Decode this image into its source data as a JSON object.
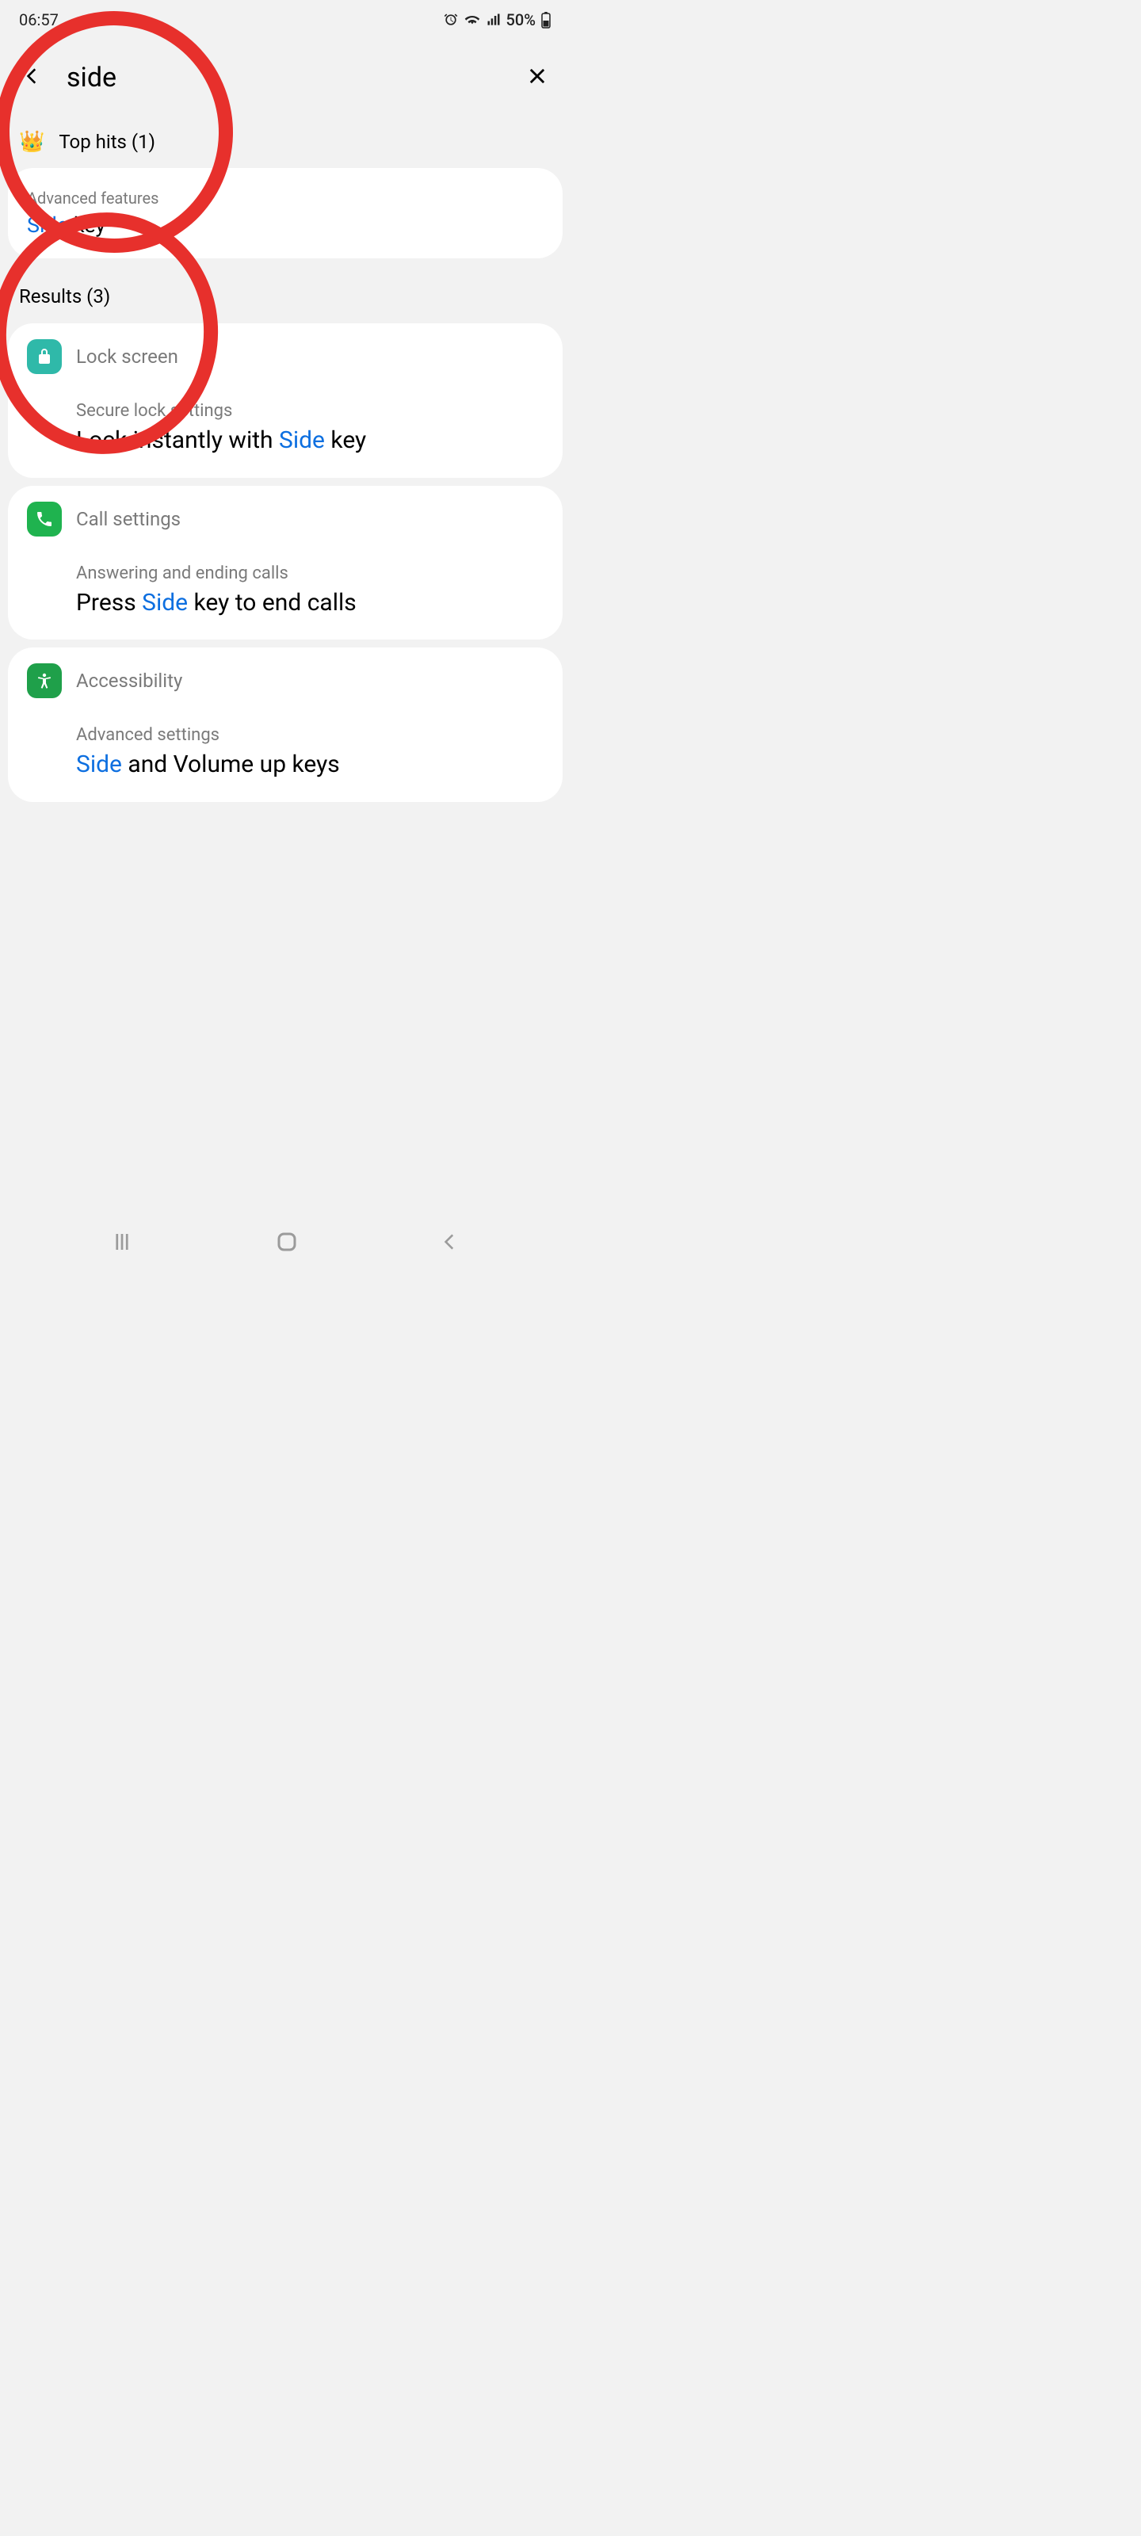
{
  "status": {
    "time": "06:57",
    "battery": "50%"
  },
  "search": {
    "query": "side"
  },
  "topHits": {
    "header": "Top hits (1)",
    "item": {
      "breadcrumb": "Advanced features",
      "title_hl": "Side",
      "title_rest": " key"
    }
  },
  "results": {
    "header": "Results (3)",
    "items": [
      {
        "category": "Lock screen",
        "icon": "lock",
        "path": "Secure lock settings",
        "title_pre": "Lock instantly with ",
        "title_hl": "Side",
        "title_post": " key"
      },
      {
        "category": "Call settings",
        "icon": "call",
        "path": "Answering and ending calls",
        "title_pre": "Press ",
        "title_hl": "Side",
        "title_post": " key to end calls"
      },
      {
        "category": "Accessibility",
        "icon": "accessibility",
        "path": "Advanced settings",
        "title_pre": "",
        "title_hl": "Side",
        "title_post": " and Volume up keys"
      }
    ]
  }
}
